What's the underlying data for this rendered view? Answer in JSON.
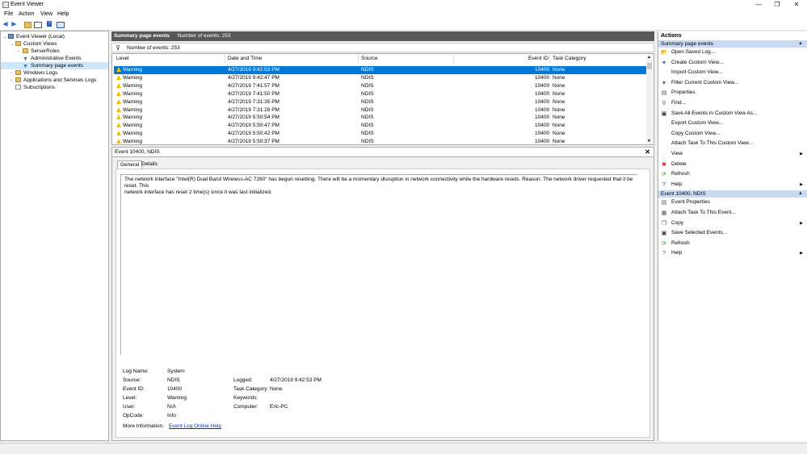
{
  "window": {
    "title": "Event Viewer"
  },
  "menu": [
    "File",
    "Action",
    "View",
    "Help"
  ],
  "tree": [
    {
      "label": "Event Viewer (Local)",
      "indent": 0,
      "twisty": "open",
      "icon": "ev",
      "selected": false
    },
    {
      "label": "Custom Views",
      "indent": 1,
      "twisty": "open",
      "icon": "folder",
      "selected": false
    },
    {
      "label": "ServerRoles",
      "indent": 2,
      "twisty": "closed",
      "icon": "folder",
      "selected": false
    },
    {
      "label": "Administrative Events",
      "indent": 2,
      "twisty": "none",
      "icon": "filter",
      "selected": false
    },
    {
      "label": "Summary page events",
      "indent": 2,
      "twisty": "none",
      "icon": "filter",
      "selected": true
    },
    {
      "label": "Windows Logs",
      "indent": 1,
      "twisty": "closed",
      "icon": "folder",
      "selected": false
    },
    {
      "label": "Applications and Services Logs",
      "indent": 1,
      "twisty": "closed",
      "icon": "folder",
      "selected": false
    },
    {
      "label": "Subscriptions",
      "indent": 1,
      "twisty": "none",
      "icon": "log",
      "selected": false
    }
  ],
  "middle": {
    "header_title": "Summary page events",
    "header_count": "Number of events: 253",
    "filter_text": "Number of events: 253",
    "columns": [
      "Level",
      "Date and Time",
      "Source",
      "Event ID",
      "Task Category"
    ],
    "rows": [
      {
        "level": "Warning",
        "date": "4/27/2019 9:42:53 PM",
        "source": "NDIS",
        "id": "10400",
        "task": "None",
        "selected": true
      },
      {
        "level": "Warning",
        "date": "4/27/2019 9:42:47 PM",
        "source": "NDIS",
        "id": "10400",
        "task": "None",
        "selected": false
      },
      {
        "level": "Warning",
        "date": "4/27/2019 7:41:57 PM",
        "source": "NDIS",
        "id": "10400",
        "task": "None",
        "selected": false
      },
      {
        "level": "Warning",
        "date": "4/27/2019 7:41:50 PM",
        "source": "NDIS",
        "id": "10400",
        "task": "None",
        "selected": false
      },
      {
        "level": "Warning",
        "date": "4/27/2019 7:31:35 PM",
        "source": "NDIS",
        "id": "10400",
        "task": "None",
        "selected": false
      },
      {
        "level": "Warning",
        "date": "4/27/2019 7:31:28 PM",
        "source": "NDIS",
        "id": "10400",
        "task": "None",
        "selected": false
      },
      {
        "level": "Warning",
        "date": "4/27/2019 5:50:54 PM",
        "source": "NDIS",
        "id": "10400",
        "task": "None",
        "selected": false
      },
      {
        "level": "Warning",
        "date": "4/27/2019 5:50:47 PM",
        "source": "NDIS",
        "id": "10400",
        "task": "None",
        "selected": false
      },
      {
        "level": "Warning",
        "date": "4/27/2019 5:50:42 PM",
        "source": "NDIS",
        "id": "10400",
        "task": "None",
        "selected": false
      },
      {
        "level": "Warning",
        "date": "4/27/2019 5:50:37 PM",
        "source": "NDIS",
        "id": "10400",
        "task": "None",
        "selected": false
      }
    ]
  },
  "detail": {
    "title": "Event 10400, NDIS",
    "tabs": [
      "General",
      "Details"
    ],
    "message_line1": "The network interface \"Intel(R) Dual Band Wireless-AC 7260\" has begun resetting.  There will be a momentary disruption in network connectivity while the hardware resets. Reason: The network driver requested that it be reset. This",
    "message_line2": "network interface has reset 2 time(s) since it was last initialized.",
    "props_left": [
      {
        "label": "Log Name:",
        "value": "System"
      },
      {
        "label": "Source:",
        "value": "NDIS"
      },
      {
        "label": "Event ID:",
        "value": "10400"
      },
      {
        "label": "Level:",
        "value": "Warning"
      },
      {
        "label": "User:",
        "value": "N/A"
      },
      {
        "label": "OpCode:",
        "value": "Info"
      }
    ],
    "props_right": [
      {
        "label": "Logged:",
        "value": "4/27/2019 9:42:53 PM"
      },
      {
        "label": "Task Category:",
        "value": "None"
      },
      {
        "label": "Keywords:",
        "value": ""
      },
      {
        "label": "Computer:",
        "value": "Eric-PC"
      }
    ],
    "more_info_label": "More Information:",
    "more_info_link": "Event Log Online Help"
  },
  "actions": {
    "title": "Actions",
    "section1": "Summary page events",
    "items1": [
      {
        "label": "Open Saved Log...",
        "icon": "open-folder-icon",
        "glyph": "📂",
        "color": "#c8a030",
        "submenu": false
      },
      {
        "label": "Create Custom View...",
        "icon": "filter-icon",
        "glyph": "▼",
        "color": "#4a6fa5",
        "submenu": false
      },
      {
        "label": "Import Custom View...",
        "icon": "blank-icon",
        "glyph": "",
        "color": "#000",
        "submenu": false
      },
      {
        "label": "Filter Current Custom View...",
        "icon": "filter-icon",
        "glyph": "▼",
        "color": "#4a6fa5",
        "submenu": false
      },
      {
        "label": "Properties",
        "icon": "properties-icon",
        "glyph": "▤",
        "color": "#555",
        "submenu": false
      },
      {
        "label": "Find...",
        "icon": "find-icon",
        "glyph": "⚲",
        "color": "#555",
        "submenu": false
      },
      {
        "label": "Save All Events in Custom View As...",
        "icon": "save-icon",
        "glyph": "▣",
        "color": "#333",
        "submenu": false
      },
      {
        "label": "Export Custom View...",
        "icon": "blank-icon",
        "glyph": "",
        "color": "#000",
        "submenu": false
      },
      {
        "label": "Copy Custom View...",
        "icon": "blank-icon",
        "glyph": "",
        "color": "#000",
        "submenu": false
      },
      {
        "label": "Attach Task To This Custom View...",
        "icon": "blank-icon",
        "glyph": "",
        "color": "#000",
        "submenu": false
      },
      {
        "label": "View",
        "icon": "blank-icon",
        "glyph": "",
        "color": "#000",
        "submenu": true
      },
      {
        "label": "Delete",
        "icon": "delete-icon",
        "glyph": "✖",
        "color": "#d11",
        "submenu": false
      },
      {
        "label": "Refresh",
        "icon": "refresh-icon",
        "glyph": "⟳",
        "color": "#2a9a2a",
        "submenu": false
      },
      {
        "label": "Help",
        "icon": "help-icon",
        "glyph": "?",
        "color": "#2255bb",
        "submenu": true
      }
    ],
    "section2": "Event 10400, NDIS",
    "items2": [
      {
        "label": "Event Properties",
        "icon": "event-properties-icon",
        "glyph": "▤",
        "color": "#555",
        "submenu": false
      },
      {
        "label": "Attach Task To This Event...",
        "icon": "task-icon",
        "glyph": "▦",
        "color": "#555",
        "submenu": false
      },
      {
        "label": "Copy",
        "icon": "copy-icon",
        "glyph": "❐",
        "color": "#555",
        "submenu": true
      },
      {
        "label": "Save Selected Events...",
        "icon": "save-icon",
        "glyph": "▣",
        "color": "#333",
        "submenu": false
      },
      {
        "label": "Refresh",
        "icon": "refresh-icon",
        "glyph": "⟳",
        "color": "#2a9a2a",
        "submenu": false
      },
      {
        "label": "Help",
        "icon": "help-icon",
        "glyph": "?",
        "color": "#2255bb",
        "submenu": true
      }
    ]
  }
}
